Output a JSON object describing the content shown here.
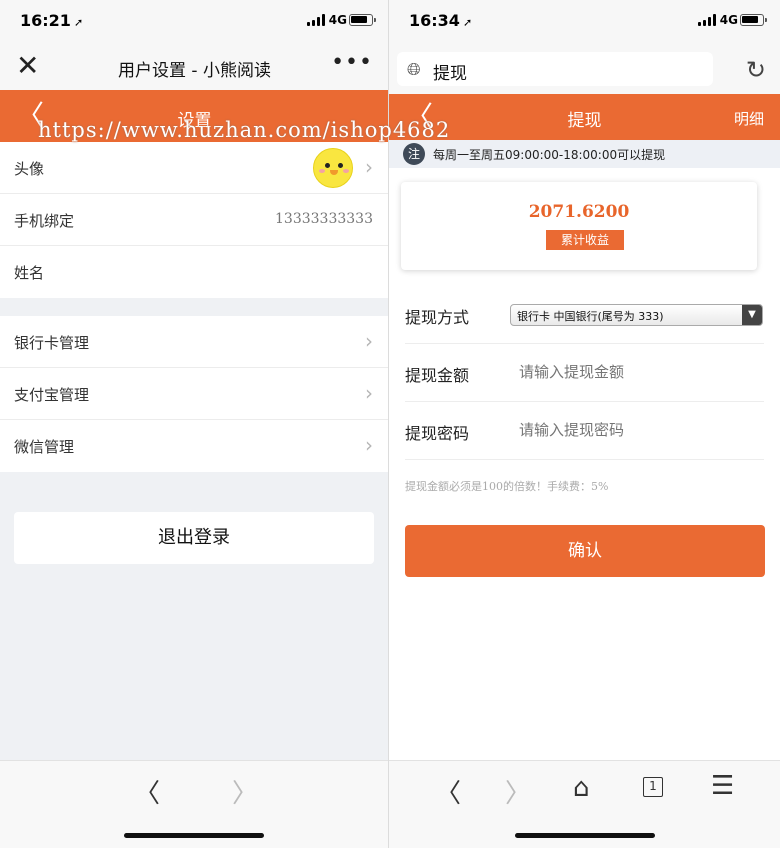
{
  "left": {
    "status": {
      "time": "16:21",
      "network": "4G"
    },
    "topbar": {
      "title": "用户设置 - 小熊阅读",
      "close_icon": "close-icon",
      "more_icon": "more-icon"
    },
    "header": {
      "title": "设置"
    },
    "watermark": "https://www.huzhan.com/ishop4682",
    "rows": [
      {
        "label": "头像"
      },
      {
        "label": "手机绑定",
        "value": "13333333333"
      },
      {
        "label": "姓名"
      }
    ],
    "rows2": [
      {
        "label": "银行卡管理"
      },
      {
        "label": "支付宝管理"
      },
      {
        "label": "微信管理"
      }
    ],
    "logout_label": "退出登录"
  },
  "right": {
    "status": {
      "time": "16:34",
      "network": "4G"
    },
    "urlbar": {
      "text": "提现"
    },
    "header": {
      "title": "提现",
      "detail": "明细"
    },
    "notice": {
      "badge": "注",
      "text": "每周一至周五09:00:00-18:00:00可以提现"
    },
    "card": {
      "amount": "2071.6200",
      "tag": "累计收益"
    },
    "form": {
      "method_label": "提现方式",
      "method_value": "银行卡 中国银行(尾号为 333)",
      "amount_label": "提现金额",
      "amount_placeholder": "请输入提现金额",
      "password_label": "提现密码",
      "password_placeholder": "请输入提现密码"
    },
    "hint": "提现金额必须是100的倍数！手续费：5%",
    "confirm_label": "确认",
    "tab_count": "1"
  },
  "colors": {
    "accent": "#ea6a33",
    "notice_bg": "#edf0f5"
  }
}
